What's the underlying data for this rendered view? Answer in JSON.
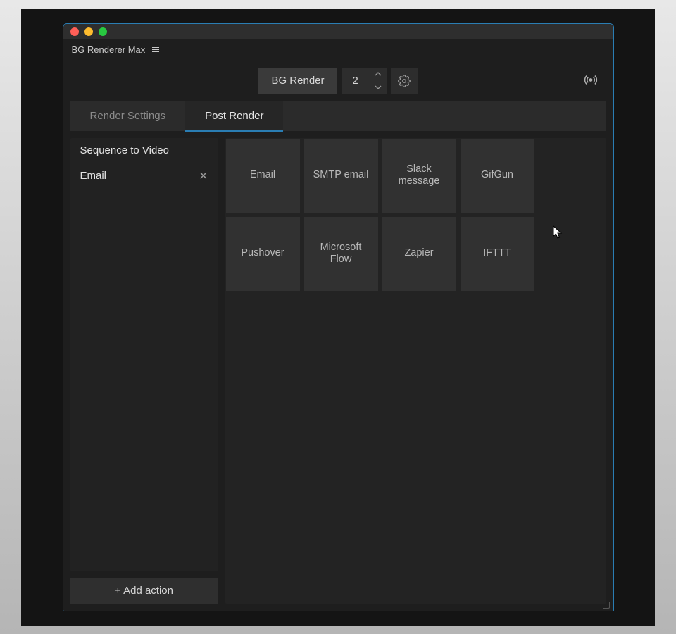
{
  "window": {
    "title": "BG Renderer Max"
  },
  "topbar": {
    "render_label": "BG Render",
    "instances": "2"
  },
  "tabs": [
    {
      "label": "Render Settings",
      "active": false
    },
    {
      "label": "Post Render",
      "active": true
    }
  ],
  "sidebar": {
    "items": [
      {
        "label": "Sequence to Video",
        "closable": false
      },
      {
        "label": "Email",
        "closable": true
      }
    ],
    "add_action_label": "+ Add action"
  },
  "tiles": [
    "Email",
    "SMTP email",
    "Slack message",
    "GifGun",
    "Pushover",
    "Microsoft Flow",
    "Zapier",
    "IFTTT"
  ]
}
